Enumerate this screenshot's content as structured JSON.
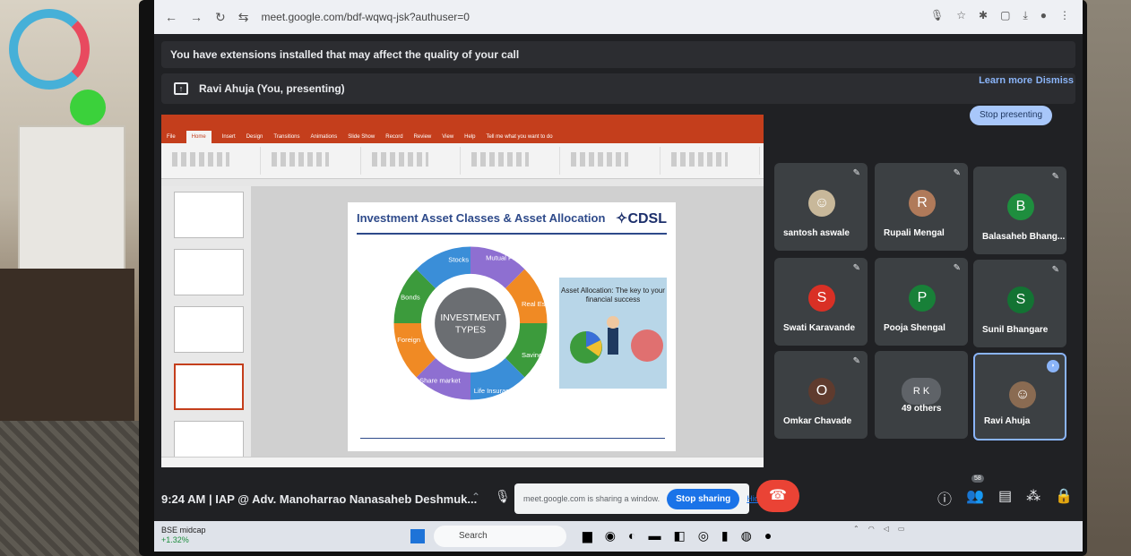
{
  "browser": {
    "url": "meet.google.com/bdf-wqwq-jsk?authuser=0"
  },
  "meet": {
    "extension_warning": "You have extensions installed that may affect the quality of your call",
    "learn_more": "Learn more",
    "dismiss": "Dismiss",
    "presenting_label": "Ravi Ahuja (You, presenting)",
    "stop_presenting": "Stop presenting",
    "time_meeting": "9:24 AM  |  IAP @ Adv. Manoharrao Nanasaheb Deshmuk...",
    "share_notice": "meet.google.com is sharing a window.",
    "stop_sharing": "Stop sharing",
    "hide": "Hide",
    "participants_badge": "58"
  },
  "ppt": {
    "tabs": [
      "File",
      "Home",
      "Insert",
      "Design",
      "Transitions",
      "Animations",
      "Slide Show",
      "Record",
      "Review",
      "View",
      "Help",
      "Tell me what you want to do"
    ],
    "slide_title": "Investment Asset Classes & Asset Allocation",
    "brand": "CDSL",
    "wheel_center": "INVESTMENT TYPES",
    "wheel_segments": [
      "Stocks",
      "Mutual Funds",
      "Real Estate",
      "Savings",
      "Life Insurance",
      "Share market",
      "Foreign",
      "Bonds"
    ],
    "asset_box": "Asset Allocation: The key to your financial success"
  },
  "tiles": [
    {
      "name": "santosh aswale",
      "initial": "",
      "color": "#c8b89a"
    },
    {
      "name": "Rupali Mengal",
      "initial": "R",
      "color": "#b07a5a"
    },
    {
      "name": "Balasaheb Bhang...",
      "initial": "B",
      "color": "#1e8e3e"
    },
    {
      "name": "Swati Karavande",
      "initial": "S",
      "color": "#d93025"
    },
    {
      "name": "Pooja Shengal",
      "initial": "P",
      "color": "#188038"
    },
    {
      "name": "Sunil Bhangare",
      "initial": "S",
      "color": "#137333"
    },
    {
      "name": "Omkar Chavade",
      "initial": "O",
      "color": "#5f3b2e"
    },
    {
      "name": "49 others",
      "initial": "R K",
      "color": "#5f6368"
    },
    {
      "name": "Ravi Ahuja",
      "initial": "",
      "color": "#8a6b52"
    }
  ],
  "taskbar": {
    "stock_name": "BSE midcap",
    "stock_change": "+1.32%",
    "search": "Search"
  },
  "colors": {
    "ppt_accent": "#c43e1c",
    "meet_bg": "#202124",
    "tile_bg": "#3c4043",
    "blue": "#1a73e8",
    "red": "#ea4335"
  }
}
